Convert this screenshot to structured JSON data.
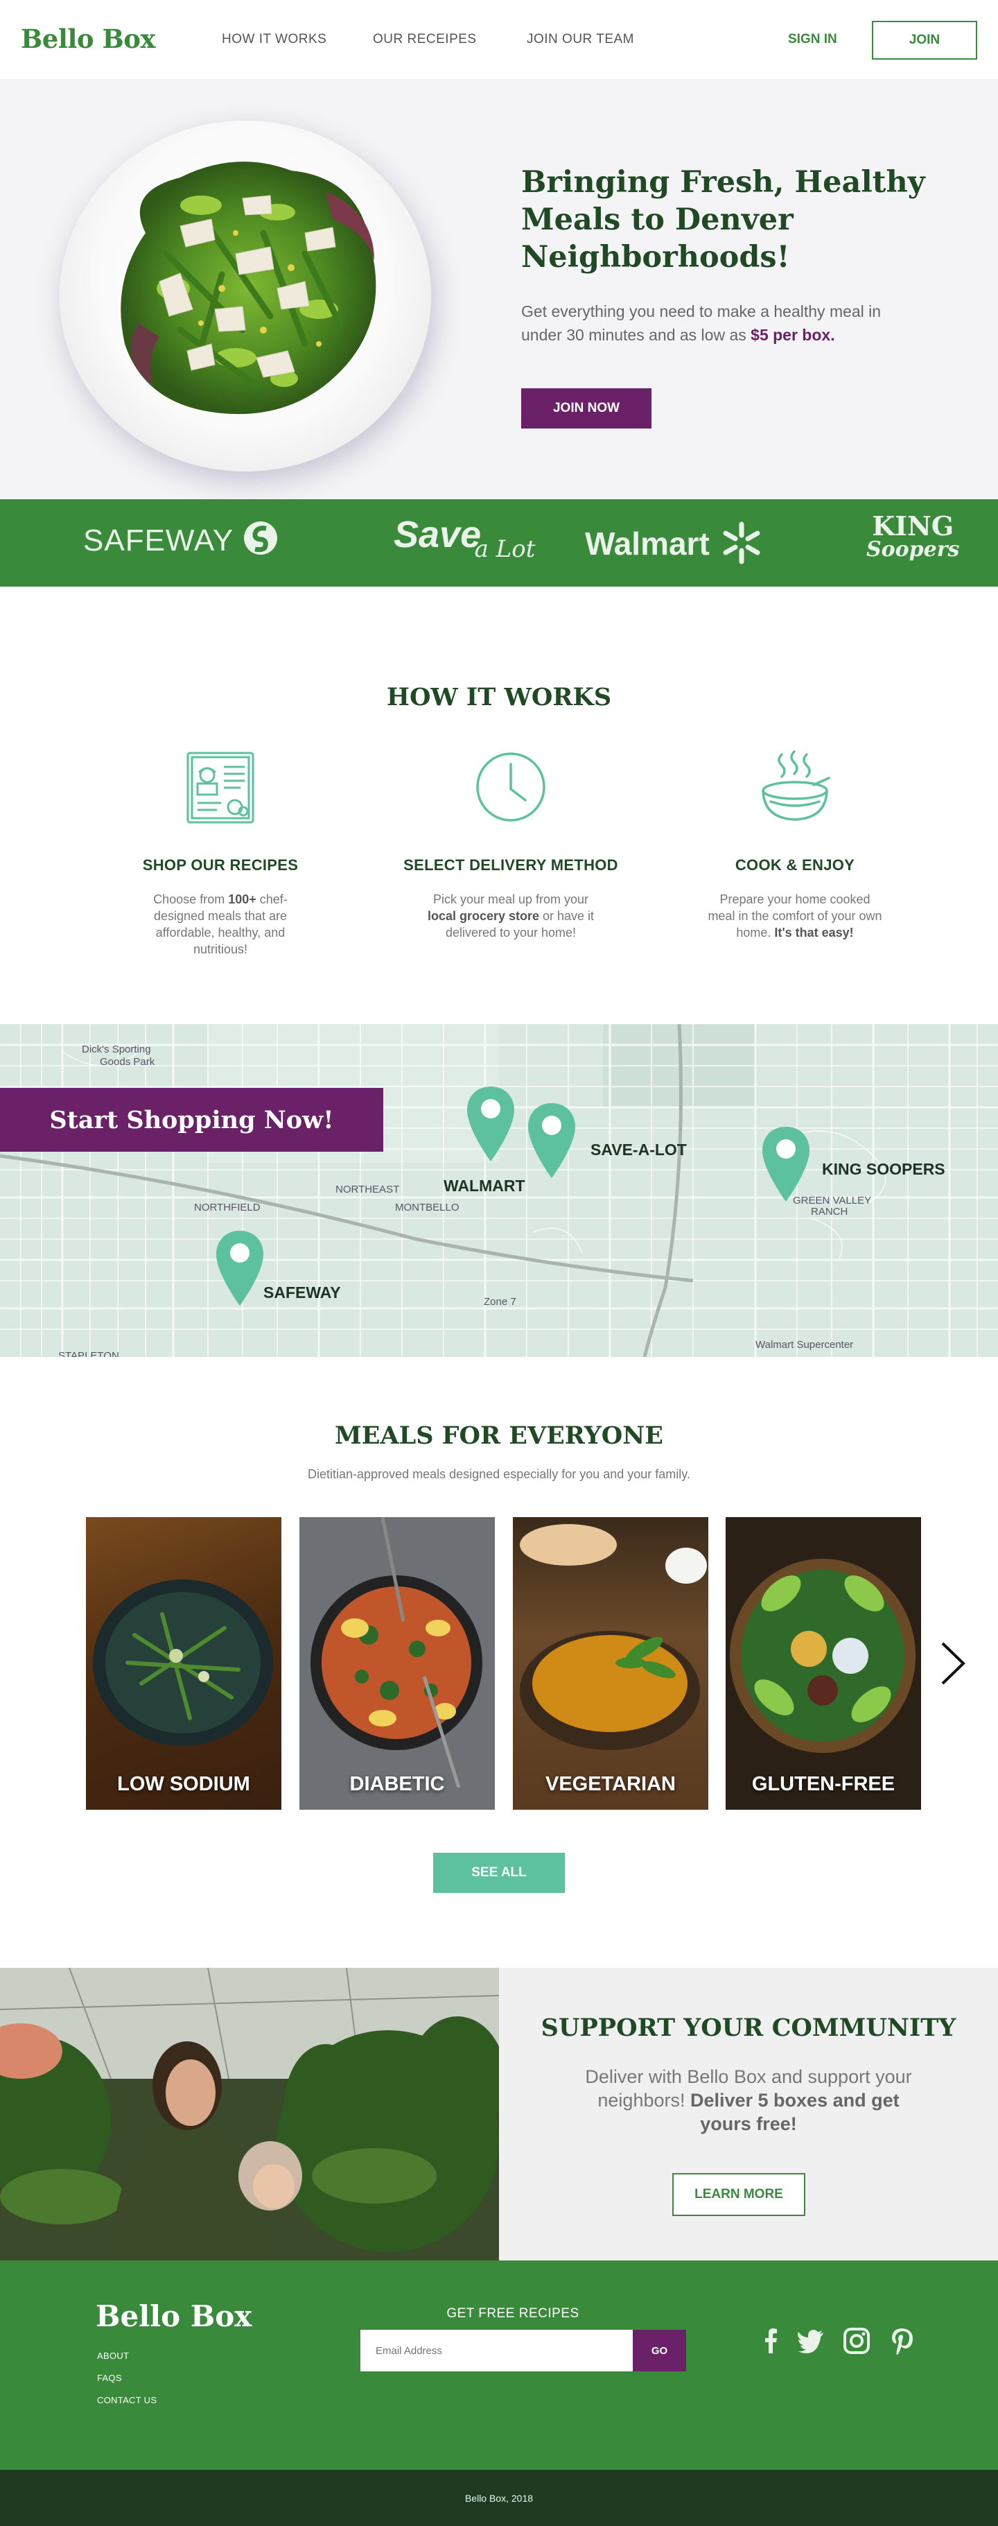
{
  "header": {
    "logo": "Bello Box",
    "nav": [
      "HOW IT WORKS",
      "OUR RECEIPES",
      "JOIN OUR TEAM"
    ],
    "sign_in": "SIGN IN",
    "join": "JOIN"
  },
  "hero": {
    "title": "Bringing Fresh, Healthy Meals to Denver Neighborhoods!",
    "text": "Get everything you need to make a healthy meal in under 30 minutes and as low as ",
    "price": "$5 per box.",
    "cta": "JOIN NOW"
  },
  "partners": {
    "safeway": "SAFEWAY",
    "savealot_1": "Save",
    "savealot_2": "a Lot",
    "walmart": "Walmart",
    "king_1": "KING",
    "king_2": "Soopers"
  },
  "how_it_works": {
    "title": "HOW IT WORKS",
    "steps": [
      {
        "title": "SHOP OUR RECIPES",
        "pre": "Choose from ",
        "bold": "100+",
        "post": " chef-designed meals that are affordable, healthy, and nutritious!",
        "icon": "recipe-icon"
      },
      {
        "title": "SELECT DELIVERY METHOD",
        "pre": "Pick your meal up from your ",
        "bold": "local grocery store",
        "post": " or have it delivered to your home!",
        "icon": "clock-icon"
      },
      {
        "title": "COOK & ENJOY",
        "pre": "Prepare your home cooked meal in the comfort of your own home. ",
        "bold": "It's that easy!",
        "post": "",
        "icon": "bowl-icon"
      }
    ]
  },
  "map": {
    "banner": "Start Shopping Now!",
    "stores": [
      "WALMART",
      "SAVE-A-LOT",
      "KING SOOPERS",
      "SAFEWAY"
    ],
    "labels": [
      "Dick's Sporting",
      "Goods Park",
      "NORTHFIELD",
      "NORTHEAST",
      "MONTBELLO",
      "GREEN VALLEY",
      "RANCH",
      "Zone 7",
      "Walmart Supercenter",
      "STAPLETON"
    ]
  },
  "meals": {
    "title": "MEALS FOR EVERYONE",
    "subtitle": "Dietitian-approved meals designed especially for you and your family.",
    "cards": [
      "LOW SODIUM",
      "DIABETIC",
      "VEGETARIAN",
      "GLUTEN-FREE"
    ],
    "see_all": "SEE ALL"
  },
  "community": {
    "title": "SUPPORT YOUR COMMUNITY",
    "text": "Deliver with Bello Box and support your neighbors! ",
    "bold": "Deliver 5 boxes and get yours free!",
    "cta": "LEARN MORE"
  },
  "footer": {
    "logo": "Bello Box",
    "links": [
      "ABOUT",
      "FAQS",
      "CONTACT US"
    ],
    "newsletter_label": "GET FREE RECIPES",
    "email_placeholder": "Email Address",
    "go": "GO",
    "social": [
      "facebook-icon",
      "twitter-icon",
      "instagram-icon",
      "pinterest-icon"
    ],
    "copyright": "Bello Box, 2018"
  },
  "colors": {
    "green": "#3a8a3c",
    "dark_green": "#1f4a24",
    "purple": "#6b2168",
    "teal": "#5dc1a0"
  }
}
